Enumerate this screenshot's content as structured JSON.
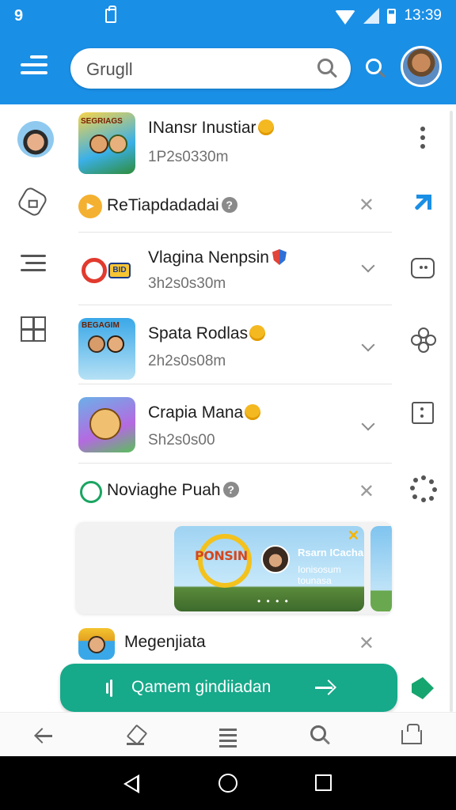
{
  "status_bar": {
    "left_glyph": "9",
    "time": "13:39"
  },
  "app_bar": {
    "search": {
      "value": "Grugll",
      "placeholder": "Grugll"
    }
  },
  "feed": {
    "items": [
      {
        "type": "app",
        "title": "INansr Inustiar",
        "subtitle": "1P2s0330m",
        "badge": "bulb-icon",
        "thumb_label": "SEGRIAGS"
      },
      {
        "type": "section",
        "title": "ReTiapdadadai",
        "badge": "help-icon"
      },
      {
        "type": "app",
        "title": "Vlagina Nenpsin",
        "subtitle": "3h2s0s30m",
        "badge": "shield-icon",
        "thumb_label": "BID"
      },
      {
        "type": "app",
        "title": "Spata Rodlas",
        "subtitle": "2h2s0s08m",
        "badge": "bulb-icon",
        "thumb_label": "BEGAGIM"
      },
      {
        "type": "app",
        "title": "Crapia Mana",
        "subtitle": "Sh2s0s00",
        "badge": "bulb-icon"
      },
      {
        "type": "section",
        "title": "Noviaghe Puah",
        "badge": "help-icon"
      },
      {
        "type": "section",
        "title": "Megenjiata"
      }
    ],
    "carousel": {
      "card_logo": "PONSIN",
      "card_title": "Rsarn ICacha",
      "card_subtitle": "Ionisosum tounasa",
      "dots": "• • • •"
    }
  },
  "cta": {
    "label": "Qamem gindiiadan"
  },
  "colors": {
    "brand_blue": "#1a8fe6",
    "cta_green": "#16a98a",
    "badge_orange": "#f4b820"
  }
}
